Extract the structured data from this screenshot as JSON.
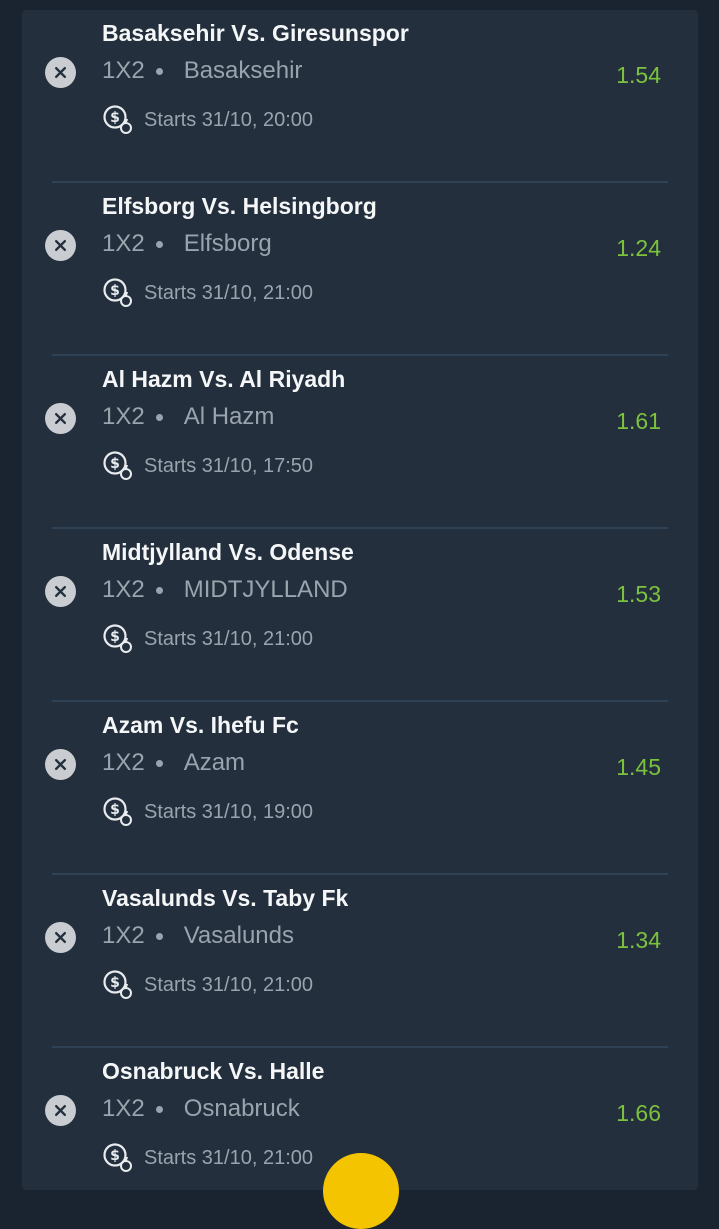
{
  "bets": [
    {
      "match": "Basaksehir Vs. Giresunspor",
      "market": "1X2",
      "selection": "Basaksehir",
      "start": "Starts 31/10, 20:00",
      "odds": "1.54"
    },
    {
      "match": "Elfsborg Vs. Helsingborg",
      "market": "1X2",
      "selection": "Elfsborg",
      "start": "Starts 31/10, 21:00",
      "odds": "1.24"
    },
    {
      "match": "Al Hazm Vs. Al Riyadh",
      "market": "1X2",
      "selection": "Al Hazm",
      "start": "Starts 31/10, 17:50",
      "odds": "1.61"
    },
    {
      "match": "Midtjylland Vs. Odense",
      "market": "1X2",
      "selection": "MIDTJYLLAND",
      "start": "Starts 31/10, 21:00",
      "odds": "1.53"
    },
    {
      "match": "Azam Vs. Ihefu Fc",
      "market": "1X2",
      "selection": "Azam",
      "start": "Starts 31/10, 19:00",
      "odds": "1.45"
    },
    {
      "match": "Vasalunds Vs. Taby Fk",
      "market": "1X2",
      "selection": "Vasalunds",
      "start": "Starts 31/10, 21:00",
      "odds": "1.34"
    },
    {
      "match": "Osnabruck Vs. Halle",
      "market": "1X2",
      "selection": "Osnabruck",
      "start": "Starts 31/10, 21:00",
      "odds": "1.66"
    }
  ],
  "icons": {
    "remove": "close-icon",
    "start": "coin-clock-icon"
  },
  "colors": {
    "background": "#1a2430",
    "panel": "#232f3c",
    "odds": "#7cc23e",
    "title": "#f4f6f8",
    "muted": "#9aa4ae",
    "fab": "#f5c400"
  }
}
